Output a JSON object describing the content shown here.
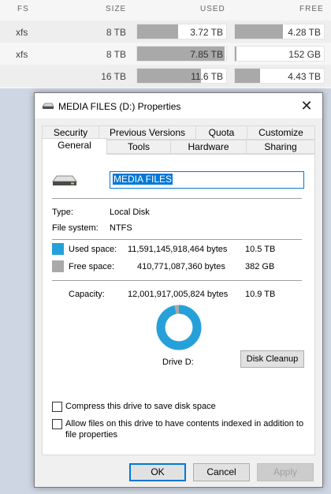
{
  "table": {
    "headers": {
      "fs": "FS",
      "size": "SIZE",
      "used": "USED",
      "free": "FREE"
    },
    "rows": [
      {
        "fs": "xfs",
        "size": "8 TB",
        "used": "3.72 TB",
        "used_fraction": 0.46,
        "free": "4.28 TB",
        "free_fraction": 0.54
      },
      {
        "fs": "xfs",
        "size": "8 TB",
        "used": "7.85 TB",
        "used_fraction": 0.98,
        "free": "152 GB",
        "free_fraction": 0.02
      },
      {
        "fs": "",
        "size": "16 TB",
        "used": "11.6 TB",
        "used_fraction": 0.72,
        "free": "4.43 TB",
        "free_fraction": 0.28
      }
    ]
  },
  "dialog": {
    "title": "MEDIA FILES (D:) Properties",
    "close_glyph": "✕",
    "tabs_row1": [
      "Security",
      "Previous Versions",
      "Quota",
      "Customize"
    ],
    "tabs_row2": [
      "General",
      "Tools",
      "Hardware",
      "Sharing"
    ],
    "active_tab": "General",
    "drive_name": "MEDIA FILES",
    "type_label": "Type:",
    "type_value": "Local Disk",
    "fs_label": "File system:",
    "fs_value": "NTFS",
    "used": {
      "label": "Used space:",
      "bytes": "11,591,145,918,464 bytes",
      "size": "10.5 TB",
      "color": "#26a0da"
    },
    "free": {
      "label": "Free space:",
      "bytes": "410,771,087,360 bytes",
      "size": "382 GB",
      "color": "#a9a9a9"
    },
    "capacity": {
      "label": "Capacity:",
      "bytes": "12,001,917,005,824 bytes",
      "size": "10.9 TB"
    },
    "used_fraction": 0.966,
    "drive_label": "Drive D:",
    "cleanup_label": "Disk Cleanup",
    "compress_label": "Compress this drive to save disk space",
    "index_label_line1": "Allow files on this drive to have contents indexed in addition to",
    "index_label_line2": "file properties",
    "ok_label": "OK",
    "cancel_label": "Cancel",
    "apply_label": "Apply"
  },
  "colors": {
    "accent": "#0078d7",
    "used": "#26a0da",
    "free": "#a9a9a9"
  }
}
